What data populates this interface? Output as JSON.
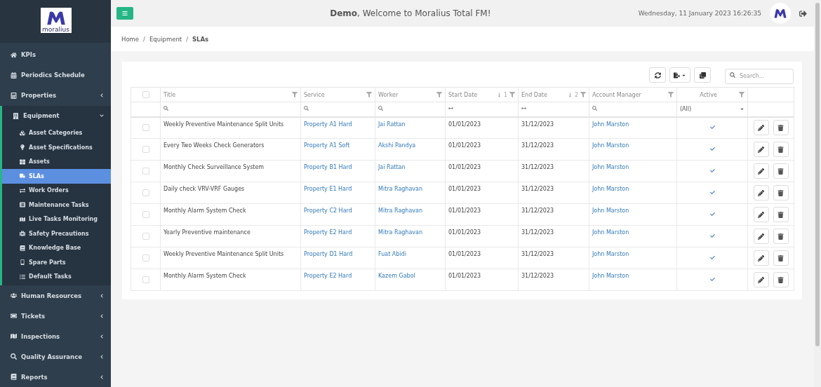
{
  "sidebar": {
    "logo_text": "moralius",
    "items": [
      {
        "label": "KPIs",
        "expandable": false,
        "expanded": false
      },
      {
        "label": "Periodics Schedule",
        "expandable": false,
        "expanded": false
      },
      {
        "label": "Properties",
        "expandable": true,
        "expanded": false
      },
      {
        "label": "Equipment",
        "expandable": true,
        "expanded": true,
        "children": [
          {
            "label": "Asset Categories",
            "selected": false
          },
          {
            "label": "Asset Specifications",
            "selected": false
          },
          {
            "label": "Assets",
            "selected": false
          },
          {
            "label": "SLAs",
            "selected": true
          },
          {
            "label": "Work Orders",
            "selected": false
          },
          {
            "label": "Maintenance Tasks",
            "selected": false
          },
          {
            "label": "Live Tasks Monitoring",
            "selected": false
          },
          {
            "label": "Safety Precautions",
            "selected": false
          },
          {
            "label": "Knowledge Base",
            "selected": false
          },
          {
            "label": "Spare Parts",
            "selected": false
          },
          {
            "label": "Default Tasks",
            "selected": false
          }
        ]
      },
      {
        "label": "Human Resources",
        "expandable": true,
        "expanded": false
      },
      {
        "label": "Tickets",
        "expandable": true,
        "expanded": false
      },
      {
        "label": "Inspections",
        "expandable": true,
        "expanded": false
      },
      {
        "label": "Quality Assurance",
        "expandable": true,
        "expanded": false
      },
      {
        "label": "Reports",
        "expandable": true,
        "expanded": false
      }
    ]
  },
  "header": {
    "welcome": "**Demo**, Welcome to Moralius Total FM!",
    "datetime": "Wednesday, 11 January 2023 16:26:35"
  },
  "breadcrumb": {
    "separator": "/",
    "items": [
      {
        "label": "Home",
        "current": false
      },
      {
        "label": "Equipment",
        "current": false
      },
      {
        "label": "SLAs",
        "current": true
      }
    ]
  },
  "search": {
    "placeholder": "Search..."
  },
  "table": {
    "select_all_checked": false,
    "columns": [
      {
        "label": "Title",
        "kind": "search"
      },
      {
        "label": "Service",
        "kind": "search"
      },
      {
        "label": "Worker",
        "kind": "search"
      },
      {
        "label": "Start Date",
        "kind": "range",
        "sort_order": "1"
      },
      {
        "label": "End Date",
        "kind": "range",
        "sort_order": "2"
      },
      {
        "label": "Account Manager",
        "kind": "search"
      },
      {
        "label": "Active",
        "kind": "select",
        "filter_value": "(All)"
      }
    ],
    "rows": [
      {
        "checked": false,
        "title": "Weekly Preventive Maintenance Split Units",
        "service": "Property A1 Hard",
        "worker": "Jai Rattan",
        "start": "01/01/2023",
        "end": "31/12/2023",
        "manager": "John Marston",
        "active": true
      },
      {
        "checked": false,
        "title": "Every Two Weeks Check Generators",
        "service": "Property A1 Soft",
        "worker": "Akshi Pandya",
        "start": "01/01/2023",
        "end": "31/12/2023",
        "manager": "John Marston",
        "active": true
      },
      {
        "checked": false,
        "title": "Monthly Check Surveillance System",
        "service": "Property B1 Hard",
        "worker": "Jai Rattan",
        "start": "01/01/2023",
        "end": "31/12/2023",
        "manager": "John Marston",
        "active": true
      },
      {
        "checked": false,
        "title": "Daily check VRV-VRF Gauges",
        "service": "Property E1 Hard",
        "worker": "Mitra Raghavan",
        "start": "01/01/2023",
        "end": "31/12/2023",
        "manager": "John Marston",
        "active": true
      },
      {
        "checked": false,
        "title": "Monthly Alarm System Check",
        "service": "Property C2 Hard",
        "worker": "Mitra Raghavan",
        "start": "01/01/2023",
        "end": "31/12/2023",
        "manager": "John Marston",
        "active": true
      },
      {
        "checked": false,
        "title": "Yearly Preventive maintenance",
        "service": "Property E2 Hard",
        "worker": "Mitra Raghavan",
        "start": "01/01/2023",
        "end": "31/12/2023",
        "manager": "John Marston",
        "active": true
      },
      {
        "checked": false,
        "title": "Weekly Preventive Maintenance Split Units",
        "service": "Property D1 Hard",
        "worker": "Fuat Abidi",
        "start": "01/01/2023",
        "end": "31/12/2023",
        "manager": "John Marston",
        "active": true
      },
      {
        "checked": false,
        "title": "Monthly Alarm System Check",
        "service": "Property E2 Hard",
        "worker": "Kazem Gabol",
        "start": "01/01/2023",
        "end": "31/12/2023",
        "manager": "John Marston",
        "active": true
      }
    ]
  }
}
